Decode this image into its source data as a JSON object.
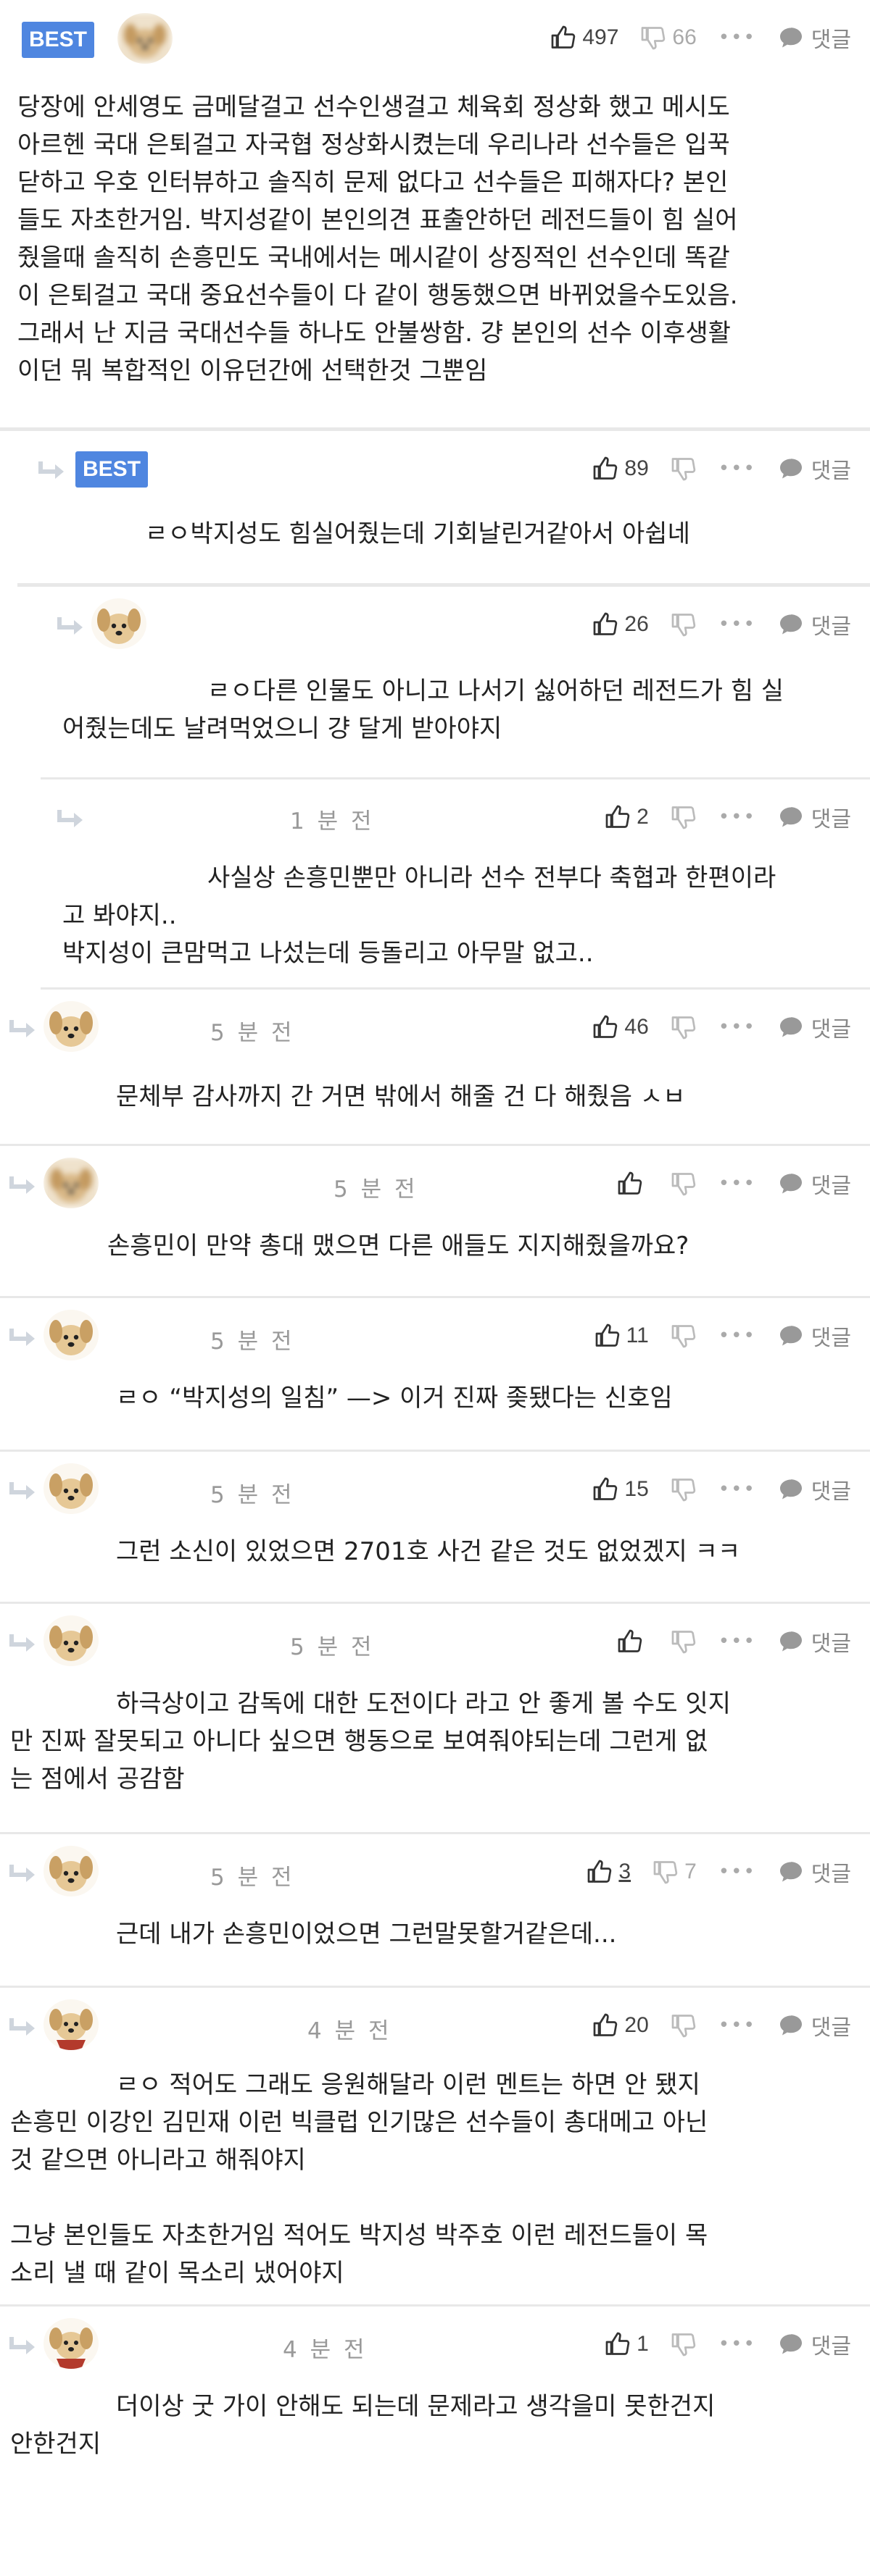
{
  "best_label": "BEST",
  "reply_label": "댓글",
  "more_label": "•••",
  "comments": [
    {
      "best": true,
      "up": "497",
      "down": "66",
      "text": "당장에 안세영도 금메달걸고 선수인생걸고 체육회 정상화 했고 메시도\n아르헨 국대 은퇴걸고 자국협 정상화시켰는데 우리나라 선수들은 입꾹\n닫하고 우호 인터뷰하고 솔직히 문제 없다고 선수들은 피해자다? 본인\n들도 자초한거임. 박지성같이 본인의견 표출안하던 레전드들이 힘 실어\n줬을때 솔직히 손흥민도 국내에서는 메시같이 상징적인 선수인데 똑같\n이 은퇴걸고 국대 중요선수들이 다 같이 행동했으면 바뀌었을수도있음.\n그래서 난 지금 국대선수들 하나도 안불쌍함. 걍 본인의 선수 이후생활\n이던 뭐 복합적인 이유던간에 선택한것 그뿐임"
    },
    {
      "best": true,
      "up": "89",
      "text": "ㄹㅇ박지성도 힘실어줬는데 기회날린거같아서 아쉽네"
    },
    {
      "up": "26",
      "text": "ㄹㅇ다른 인물도 아니고 나서기 싫어하던 레전드가 힘 실\n어줬는데도 날려먹었으니 걍 달게 받아야지"
    },
    {
      "time": "1 분 전",
      "up": "2",
      "text": "사실상 손흥민뿐만 아니라 선수 전부다 축협과 한편이라\n고 봐야지..\n박지성이 큰맘먹고 나섰는데 등돌리고 아무말 없고.."
    },
    {
      "time": "5 분 전",
      "up": "46",
      "text": "문체부 감사까지 간 거면 밖에서 해줄 건 다 해줬음 ㅅㅂ"
    },
    {
      "time": "5 분 전",
      "up": "",
      "text": "손흥민이 만약 총대 맸으면 다른 애들도 지지해줬을까요?"
    },
    {
      "time": "5 분 전",
      "up": "11",
      "text": "ㄹㅇ “박지성의 일침” —> 이거 진짜 좆됐다는 신호임"
    },
    {
      "time": "5 분 전",
      "up": "15",
      "text": "그런 소신이 있었으면 2701호 사건 같은 것도 없었겠지 ㅋㅋ"
    },
    {
      "time": "5 분 전",
      "up": "",
      "text": "하극상이고 감독에 대한 도전이다 라고 안 좋게 볼 수도 잇지\n만 진짜 잘못되고 아니다 싶으면 행동으로 보여줘야되는데 그런게 없\n는 점에서 공감함"
    },
    {
      "time": "5 분 전",
      "up": "3",
      "down": "7",
      "text": "근데 내가 손흥민이었으면 그런말못할거같은데..."
    },
    {
      "time": "4 분 전",
      "up": "20",
      "text": "ㄹㅇ 적어도 그래도 응원해달라 이런 멘트는 하면 안 됐지\n손흥민 이강인 김민재 이런 빅클럽 인기많은 선수들이 총대메고 아닌\n것 같으면 아니라고 해줘야지\n\n그냥 본인들도 자초한거임 적어도 박지성 박주호 이런 레전드들이 목\n소리 낼 때 같이 목소리 냈어야지"
    },
    {
      "time": "4 분 전",
      "up": "1",
      "text": "더이상 굿 가이 안해도 되는데 문제라고 생각을미 못한건지\n안한건지"
    }
  ]
}
